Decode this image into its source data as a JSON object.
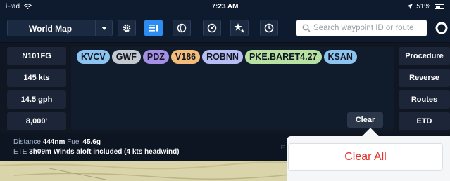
{
  "status_bar": {
    "device": "iPad",
    "time": "7:23 AM",
    "battery": "51%"
  },
  "toolbar": {
    "map_select": "World Map",
    "search_placeholder": "Search waypoint ID or route"
  },
  "left_panel": {
    "items": [
      {
        "label": "N101FG"
      },
      {
        "label": "145 kts"
      },
      {
        "label": "14.5 gph"
      },
      {
        "label": "8,000'"
      }
    ]
  },
  "route": {
    "chips": [
      {
        "label": "KVCV",
        "color": "#8cc3ef"
      },
      {
        "label": "GWF",
        "color": "#c4c8cf"
      },
      {
        "label": "PDZ",
        "color": "#a48fe4"
      },
      {
        "label": "V186",
        "color": "#f3bc7b"
      },
      {
        "label": "ROBNN",
        "color": "#b7bcf3"
      },
      {
        "label": "PKE.BARET4.27",
        "color": "#b7e1a3"
      },
      {
        "label": "KSAN",
        "color": "#8cc3ef"
      }
    ],
    "clear_label": "Clear"
  },
  "right_panel": {
    "items": [
      {
        "label": "Procedure"
      },
      {
        "label": "Reverse"
      },
      {
        "label": "Routes"
      },
      {
        "label": "ETD"
      }
    ]
  },
  "info": {
    "distance_label": "Distance",
    "distance_value": "444nm",
    "fuel_label": "Fuel",
    "fuel_value": "45.6g",
    "ete_label": "ETE",
    "ete_value": "3h09m",
    "winds_note": "Winds aloft included (4 kts headwind)",
    "partial_letter": "E"
  },
  "popover": {
    "clear_all_label": "Clear All"
  },
  "colors": {
    "accent": "#2d8cf0",
    "destructive": "#e4322b"
  },
  "icons": [
    "wifi-icon",
    "location-arrow-icon",
    "battery-icon",
    "gear-icon",
    "list-icon",
    "globe-icon",
    "gauge-icon",
    "stars-icon",
    "clock-icon",
    "search-icon",
    "circle-icon"
  ]
}
